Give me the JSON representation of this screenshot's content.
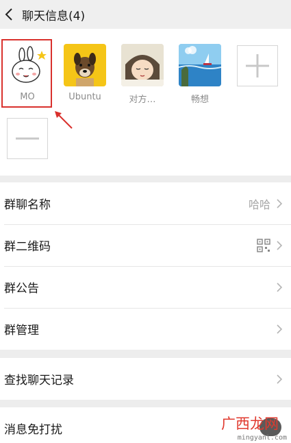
{
  "header": {
    "title": "聊天信息(4)",
    "back_icon": "chevron-left-icon"
  },
  "members": [
    {
      "name": "MO",
      "avatar": "rabbit-cartoon"
    },
    {
      "name": "Ubuntu",
      "avatar": "dog-on-yellow"
    },
    {
      "name": "对方…",
      "avatar": "sleeping-cartoon"
    },
    {
      "name": "畅想",
      "avatar": "seascape"
    }
  ],
  "member_actions": {
    "add_icon": "plus-icon",
    "remove_icon": "minus-icon"
  },
  "settings": {
    "group_name": {
      "label": "群聊名称",
      "value": "哈哈"
    },
    "qr_code": {
      "label": "群二维码",
      "icon": "qr-code-icon"
    },
    "announcement": {
      "label": "群公告"
    },
    "manage": {
      "label": "群管理"
    },
    "search_history": {
      "label": "查找聊天记录"
    },
    "mute": {
      "label": "消息免打扰"
    }
  },
  "watermark": {
    "cn": "广西龙网",
    "en": "mingyanl.com"
  },
  "colors": {
    "highlight": "#d9302c",
    "arrow": "#d9302c",
    "background": "#ededed"
  }
}
